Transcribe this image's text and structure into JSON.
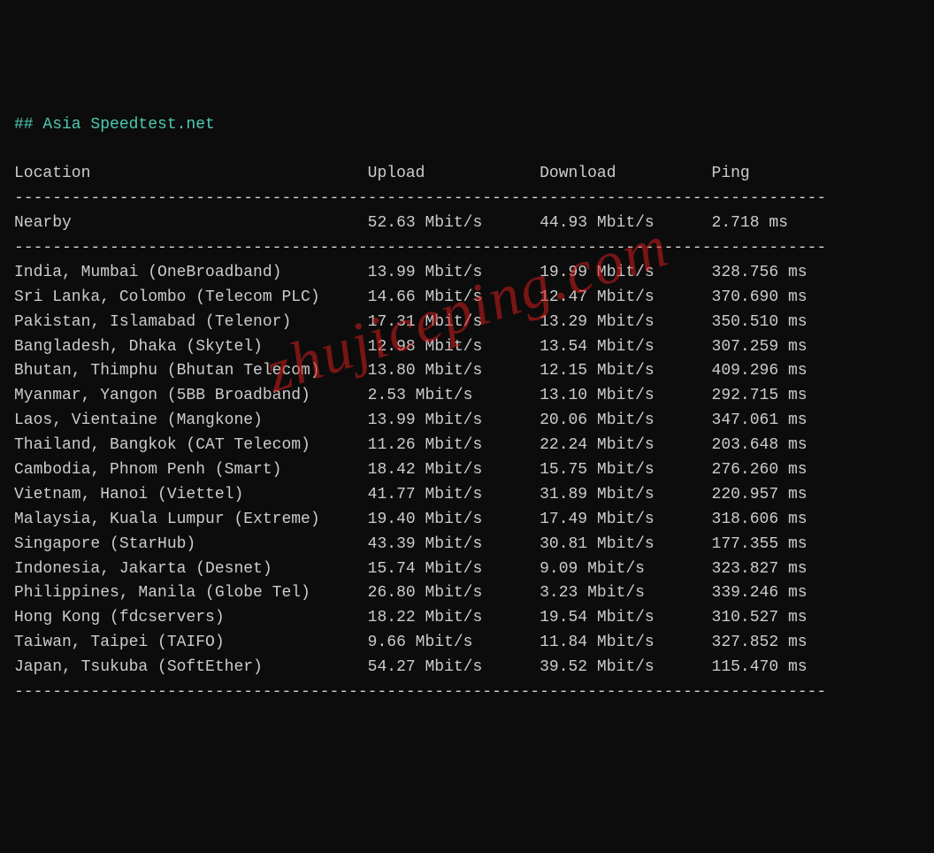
{
  "title_prefix": "## ",
  "title": "Asia Speedtest.net",
  "watermark": "zhujiceping.com",
  "columns": {
    "location": "Location",
    "upload": "Upload",
    "download": "Download",
    "ping": "Ping"
  },
  "col_widths": {
    "location": 37,
    "upload": 18,
    "download": 18,
    "ping": 12
  },
  "nearby": {
    "location": "Nearby",
    "upload": "52.63 Mbit/s",
    "download": "44.93 Mbit/s",
    "ping": "2.718 ms"
  },
  "rows": [
    {
      "location": "India, Mumbai (OneBroadband)",
      "upload": "13.99 Mbit/s",
      "download": "19.99 Mbit/s",
      "ping": "328.756 ms"
    },
    {
      "location": "Sri Lanka, Colombo (Telecom PLC)",
      "upload": "14.66 Mbit/s",
      "download": "12.47 Mbit/s",
      "ping": "370.690 ms"
    },
    {
      "location": "Pakistan, Islamabad (Telenor)",
      "upload": "17.31 Mbit/s",
      "download": "13.29 Mbit/s",
      "ping": "350.510 ms"
    },
    {
      "location": "Bangladesh, Dhaka (Skytel)",
      "upload": "12.98 Mbit/s",
      "download": "13.54 Mbit/s",
      "ping": "307.259 ms"
    },
    {
      "location": "Bhutan, Thimphu (Bhutan Telecom)",
      "upload": "13.80 Mbit/s",
      "download": "12.15 Mbit/s",
      "ping": "409.296 ms"
    },
    {
      "location": "Myanmar, Yangon (5BB Broadband)",
      "upload": "2.53 Mbit/s",
      "download": "13.10 Mbit/s",
      "ping": "292.715 ms"
    },
    {
      "location": "Laos, Vientaine (Mangkone)",
      "upload": "13.99 Mbit/s",
      "download": "20.06 Mbit/s",
      "ping": "347.061 ms"
    },
    {
      "location": "Thailand, Bangkok (CAT Telecom)",
      "upload": "11.26 Mbit/s",
      "download": "22.24 Mbit/s",
      "ping": "203.648 ms"
    },
    {
      "location": "Cambodia, Phnom Penh (Smart)",
      "upload": "18.42 Mbit/s",
      "download": "15.75 Mbit/s",
      "ping": "276.260 ms"
    },
    {
      "location": "Vietnam, Hanoi (Viettel)",
      "upload": "41.77 Mbit/s",
      "download": "31.89 Mbit/s",
      "ping": "220.957 ms"
    },
    {
      "location": "Malaysia, Kuala Lumpur (Extreme)",
      "upload": "19.40 Mbit/s",
      "download": "17.49 Mbit/s",
      "ping": "318.606 ms"
    },
    {
      "location": "Singapore (StarHub)",
      "upload": "43.39 Mbit/s",
      "download": "30.81 Mbit/s",
      "ping": "177.355 ms"
    },
    {
      "location": "Indonesia, Jakarta (Desnet)",
      "upload": "15.74 Mbit/s",
      "download": "9.09 Mbit/s",
      "ping": "323.827 ms"
    },
    {
      "location": "Philippines, Manila (Globe Tel)",
      "upload": "26.80 Mbit/s",
      "download": "3.23 Mbit/s",
      "ping": "339.246 ms"
    },
    {
      "location": "Hong Kong (fdcservers)",
      "upload": "18.22 Mbit/s",
      "download": "19.54 Mbit/s",
      "ping": "310.527 ms"
    },
    {
      "location": "Taiwan, Taipei (TAIFO)",
      "upload": "9.66 Mbit/s",
      "download": "11.84 Mbit/s",
      "ping": "327.852 ms"
    },
    {
      "location": "Japan, Tsukuba (SoftEther)",
      "upload": "54.27 Mbit/s",
      "download": "39.52 Mbit/s",
      "ping": "115.470 ms"
    }
  ]
}
